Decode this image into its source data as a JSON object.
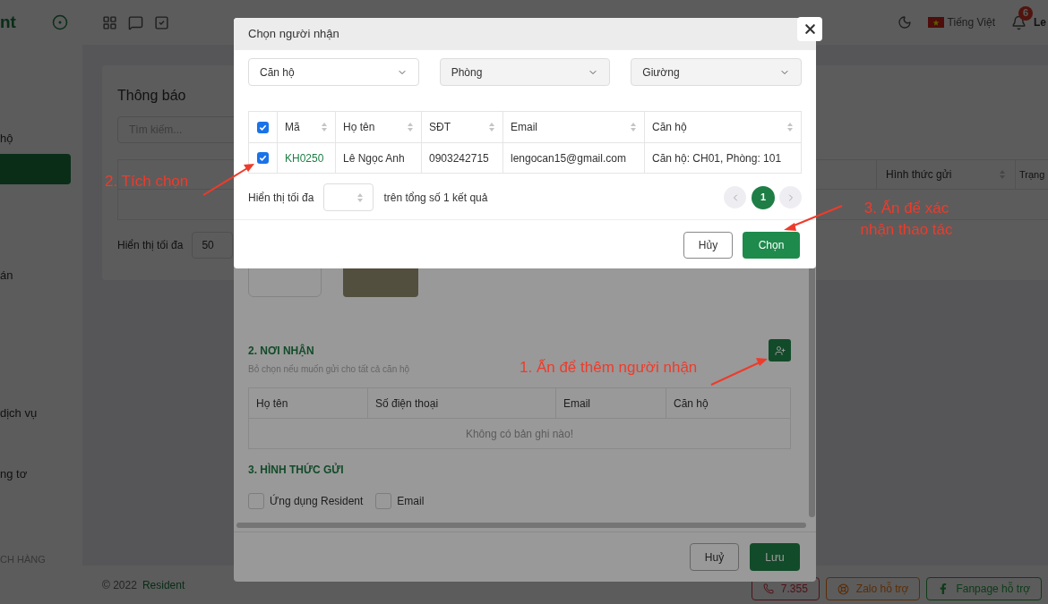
{
  "sidebar": {
    "logo": "nt",
    "items": [
      {
        "label": "hộ",
        "selected": false
      },
      {
        "selected": true
      },
      {
        "label": "án",
        "selected": false
      },
      {
        "label": "dịch vụ",
        "selected": false
      },
      {
        "label": "ng tơ",
        "selected": false
      }
    ],
    "section": "CH HÀNG"
  },
  "topbar": {
    "language": "Tiếng Việt",
    "notifications": "6",
    "user": "Le"
  },
  "page": {
    "title": "Thông báo",
    "search_placeholder": "Tìm kiếm...",
    "columns": [
      "Hình thức gửi",
      "Trạng"
    ],
    "page_size_label": "Hiển thị tối đa",
    "page_size": "50"
  },
  "footer": {
    "copyright": "© 2022",
    "brand": "Resident",
    "support": [
      {
        "kind": "phone",
        "label": "7.355"
      },
      {
        "kind": "zalo",
        "label": "Zalo hỗ trợ"
      },
      {
        "kind": "fanpage",
        "label": "Fanpage hỗ trợ"
      }
    ]
  },
  "form_dialog": {
    "recipients_title": "2. NƠI NHẬN",
    "recipients_hint": "Bỏ chọn nếu muốn gửi cho tất cả căn hộ",
    "columns": [
      "Họ tên",
      "Số điện thoại",
      "Email",
      "Căn hộ"
    ],
    "empty_text": "Không có bản ghi nào!",
    "send_title": "3. HÌNH THỨC GỬI",
    "channels": [
      {
        "label": "Ứng dụng Resident",
        "checked": false
      },
      {
        "label": "Email",
        "checked": false
      }
    ],
    "cancel": "Huỷ",
    "save": "Lưu"
  },
  "picker_dialog": {
    "title": "Chọn người nhận",
    "filters": [
      {
        "label": "Căn hộ",
        "disabled": false
      },
      {
        "label": "Phòng",
        "disabled": true
      },
      {
        "label": "Giường",
        "disabled": true
      }
    ],
    "all_checked": true,
    "columns": [
      "Mã",
      "Họ tên",
      "SĐT",
      "Email",
      "Căn hộ"
    ],
    "rows": [
      {
        "checked": true,
        "cells": [
          "KH0250",
          "Lê Ngọc Anh",
          "0903242715",
          "lengocan15@gmail.com",
          "Căn hộ: CH01, Phòng: 101"
        ]
      }
    ],
    "page_size_label": "Hiển thị tối đa",
    "total": "trên tổng số 1 kết quả",
    "pages": [
      {
        "label": "1",
        "selected": true
      }
    ],
    "cancel": "Hủy",
    "confirm": "Chọn"
  },
  "annotations": [
    {
      "text": "2. Tích chọn"
    },
    {
      "text": "1. Ấn để thêm người nhận"
    },
    {
      "text": "3. Ấn để xác nhận thao tác"
    }
  ]
}
